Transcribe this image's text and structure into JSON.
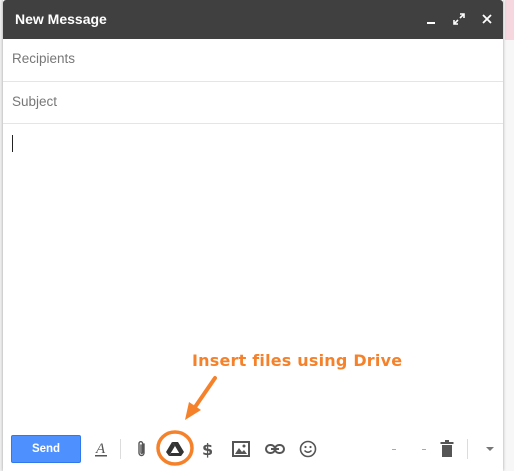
{
  "window": {
    "title": "New Message"
  },
  "titlebar_icons": [
    "minimize-icon",
    "expand-icon",
    "close-icon"
  ],
  "fields": {
    "recipients_placeholder": "Recipients",
    "subject_placeholder": "Subject"
  },
  "annotation": {
    "text": "Insert files using Drive",
    "color": "#f5822b"
  },
  "toolbar": {
    "send_label": "Send",
    "icons": [
      "formatting-icon",
      "attach-icon",
      "drive-icon",
      "money-icon",
      "photo-icon",
      "link-icon",
      "emoji-icon",
      "delete-icon",
      "more-options-icon"
    ]
  },
  "colors": {
    "titlebar": "#404040",
    "send": "#4d90fe",
    "accent": "#f5822b"
  }
}
